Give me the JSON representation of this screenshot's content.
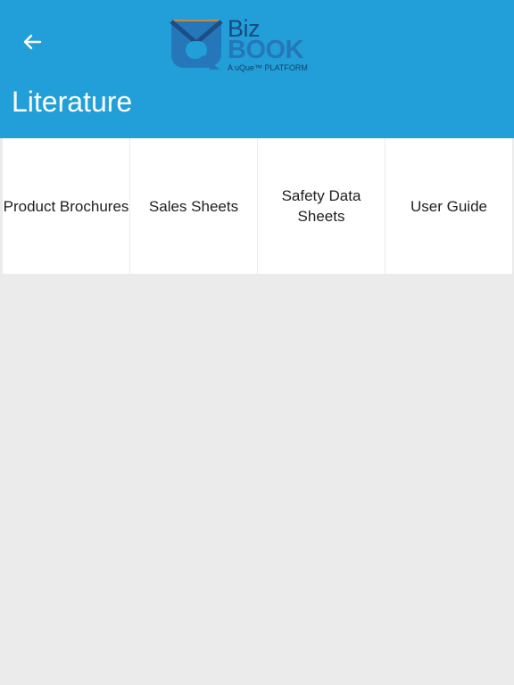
{
  "header": {
    "back_icon": "arrow-left-icon",
    "title": "Literature",
    "background_color": "#229fd8"
  },
  "logo": {
    "line1": "Biz",
    "line2": "BOOK",
    "tagline": "A uQue™ PLATFORM"
  },
  "tiles": [
    {
      "label": "Product Brochures"
    },
    {
      "label": "Sales Sheets"
    },
    {
      "label": "Safety Data Sheets"
    },
    {
      "label": "User Guide"
    }
  ]
}
